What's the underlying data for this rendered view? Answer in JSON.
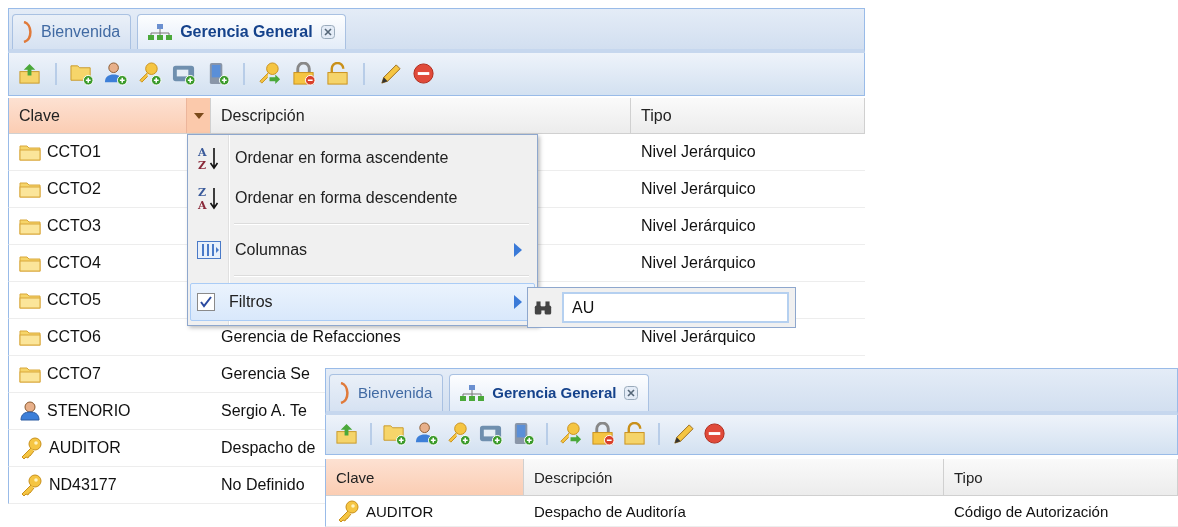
{
  "panels": [
    {
      "tabs": [
        {
          "label": "Bienvenida",
          "kind": "welcome",
          "selected": false,
          "closable": false
        },
        {
          "label": "Gerencia General",
          "kind": "tree",
          "selected": true,
          "closable": true
        }
      ],
      "columns": [
        {
          "label": "Clave",
          "highlighted": true,
          "menu_trigger": true
        },
        {
          "label": "Descripción",
          "highlighted": false,
          "menu_trigger": false
        },
        {
          "label": "Tipo",
          "highlighted": false,
          "menu_trigger": false
        }
      ],
      "rows": [
        {
          "kind": "folder",
          "clave": "CCTO1",
          "tipo": "Nivel Jerárquico"
        },
        {
          "kind": "folder",
          "clave": "CCTO2",
          "tipo": "Nivel Jerárquico"
        },
        {
          "kind": "folder",
          "clave": "CCTO3",
          "tipo": "Nivel Jerárquico"
        },
        {
          "kind": "folder",
          "clave": "CCTO4",
          "tipo": "Nivel Jerárquico"
        },
        {
          "kind": "folder",
          "clave": "CCTO5"
        },
        {
          "kind": "folder",
          "clave": "CCTO6",
          "descripcion": "Gerencia de Refacciones",
          "tipo": "Nivel Jerárquico"
        },
        {
          "kind": "folder",
          "clave": "CCTO7",
          "descripcion": "Gerencia Se"
        },
        {
          "kind": "user",
          "clave": "STENORIO",
          "descripcion": "Sergio A. Te"
        },
        {
          "kind": "key",
          "clave": "AUDITOR",
          "descripcion": "Despacho de"
        },
        {
          "kind": "key",
          "clave": "ND43177",
          "descripcion": "No Definido"
        }
      ],
      "column_menu": {
        "groups": [
          [
            {
              "kind": "sort",
              "icon_letters": [
                "A",
                "Z"
              ],
              "label": "Ordenar en forma ascendente",
              "submenu": false,
              "selected": false
            },
            {
              "kind": "sort",
              "icon_letters": [
                "Z",
                "A"
              ],
              "label": "Ordenar en forma descendente",
              "submenu": false,
              "selected": false
            }
          ],
          [
            {
              "kind": "columns",
              "label": "Columnas",
              "submenu": true,
              "selected": false
            }
          ],
          [
            {
              "kind": "check",
              "label": "Filtros",
              "checked": true,
              "submenu": true,
              "selected": true
            }
          ]
        ],
        "filter": {
          "value": "AU"
        }
      }
    },
    {
      "tabs": [
        {
          "label": "Bienvenida",
          "kind": "welcome",
          "selected": false,
          "closable": false
        },
        {
          "label": "Gerencia General",
          "kind": "tree",
          "selected": true,
          "closable": true
        }
      ],
      "columns": [
        {
          "label": "Clave",
          "highlighted": true,
          "menu_trigger": false
        },
        {
          "label": "Descripción",
          "highlighted": false,
          "menu_trigger": false
        },
        {
          "label": "Tipo",
          "highlighted": false,
          "menu_trigger": false
        }
      ],
      "rows": [
        {
          "kind": "key",
          "clave": "AUDITOR",
          "descripcion": "Despacho de Auditoría",
          "tipo": "Código de Autorización"
        }
      ]
    }
  ]
}
